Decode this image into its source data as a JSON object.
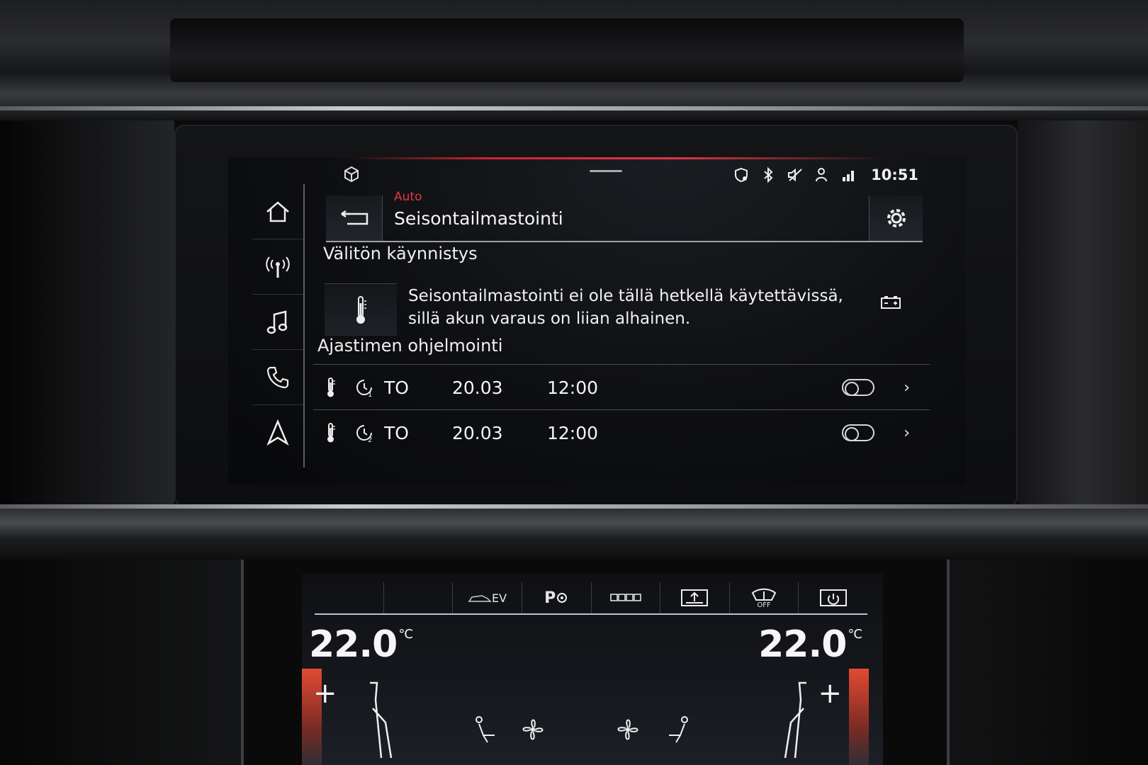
{
  "status": {
    "time": "10:51",
    "icons": [
      "shield-icon",
      "bluetooth-icon",
      "mute-icon",
      "person-icon",
      "signal-icon"
    ]
  },
  "nav": {
    "items": [
      "home-icon",
      "radio-icon",
      "music-icon",
      "phone-icon",
      "navigation-icon"
    ]
  },
  "header": {
    "breadcrumb": "Auto",
    "title": "Seisontailmastointi"
  },
  "immediate": {
    "title": "Välitön käynnistys",
    "message": "Seisontailmastointi ei ole tällä hetkellä käytettävissä, sillä akun varaus on liian alhainen."
  },
  "timers": {
    "title": "Ajastimen ohjelmointi",
    "rows": [
      {
        "day": "TO",
        "date": "20.03",
        "time": "12:00",
        "index": "1",
        "enabled": false
      },
      {
        "day": "TO",
        "date": "20.03",
        "time": "12:00",
        "index": "2",
        "enabled": false
      }
    ]
  },
  "climate": {
    "left_temp": "22.0",
    "right_temp": "22.0",
    "unit": "°C",
    "tabs": [
      "",
      "",
      "EV",
      "P",
      "",
      "",
      "OFF",
      ""
    ]
  },
  "colors": {
    "accent_red": "#e23a3f",
    "text": "#f2f2f2"
  }
}
